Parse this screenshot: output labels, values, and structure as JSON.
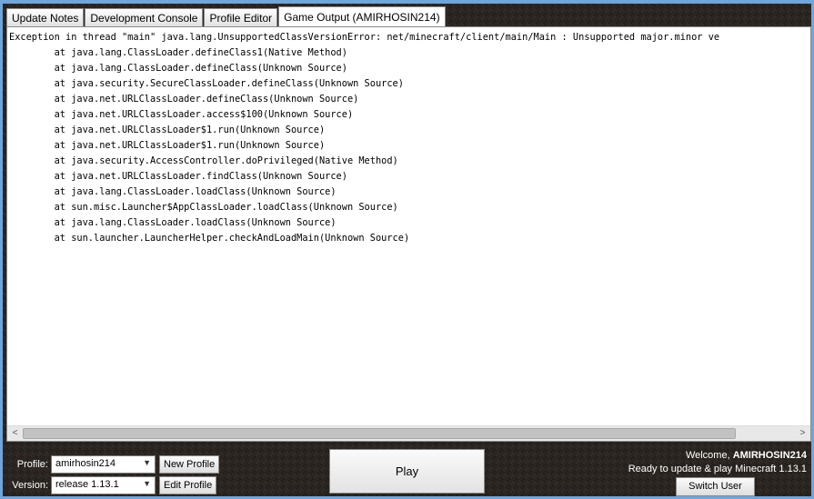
{
  "tabs": [
    {
      "label": "Update Notes"
    },
    {
      "label": "Development Console"
    },
    {
      "label": "Profile Editor"
    },
    {
      "label": "Game Output (AMIRHOSIN214)"
    }
  ],
  "console": {
    "lines": [
      "Exception in thread \"main\" java.lang.UnsupportedClassVersionError: net/minecraft/client/main/Main : Unsupported major.minor ve",
      "\tat java.lang.ClassLoader.defineClass1(Native Method)",
      "\tat java.lang.ClassLoader.defineClass(Unknown Source)",
      "\tat java.security.SecureClassLoader.defineClass(Unknown Source)",
      "\tat java.net.URLClassLoader.defineClass(Unknown Source)",
      "\tat java.net.URLClassLoader.access$100(Unknown Source)",
      "\tat java.net.URLClassLoader$1.run(Unknown Source)",
      "\tat java.net.URLClassLoader$1.run(Unknown Source)",
      "\tat java.security.AccessController.doPrivileged(Native Method)",
      "\tat java.net.URLClassLoader.findClass(Unknown Source)",
      "\tat java.lang.ClassLoader.loadClass(Unknown Source)",
      "\tat sun.misc.Launcher$AppClassLoader.loadClass(Unknown Source)",
      "\tat java.lang.ClassLoader.loadClass(Unknown Source)",
      "\tat sun.launcher.LauncherHelper.checkAndLoadMain(Unknown Source)"
    ],
    "text": ""
  },
  "scrollbar": {
    "left_arrow": "<",
    "right_arrow": ">"
  },
  "profile": {
    "label": "Profile:",
    "value": "amirhosin214",
    "new_button": "New Profile"
  },
  "version": {
    "label": "Version:",
    "value": "release 1.13.1",
    "edit_button": "Edit Profile"
  },
  "play_button": "Play",
  "welcome": {
    "prefix": "Welcome, ",
    "username": "AMIRHOSIN214",
    "status": "Ready to update & play Minecraft 1.13.1"
  },
  "switch_user_button": "Switch User",
  "icons": {
    "dropdown": "chevron-down-icon"
  },
  "colors": {
    "background_dark": "#2a2520",
    "desktop": "#6ea6dd",
    "console_bg": "#ffffff"
  }
}
